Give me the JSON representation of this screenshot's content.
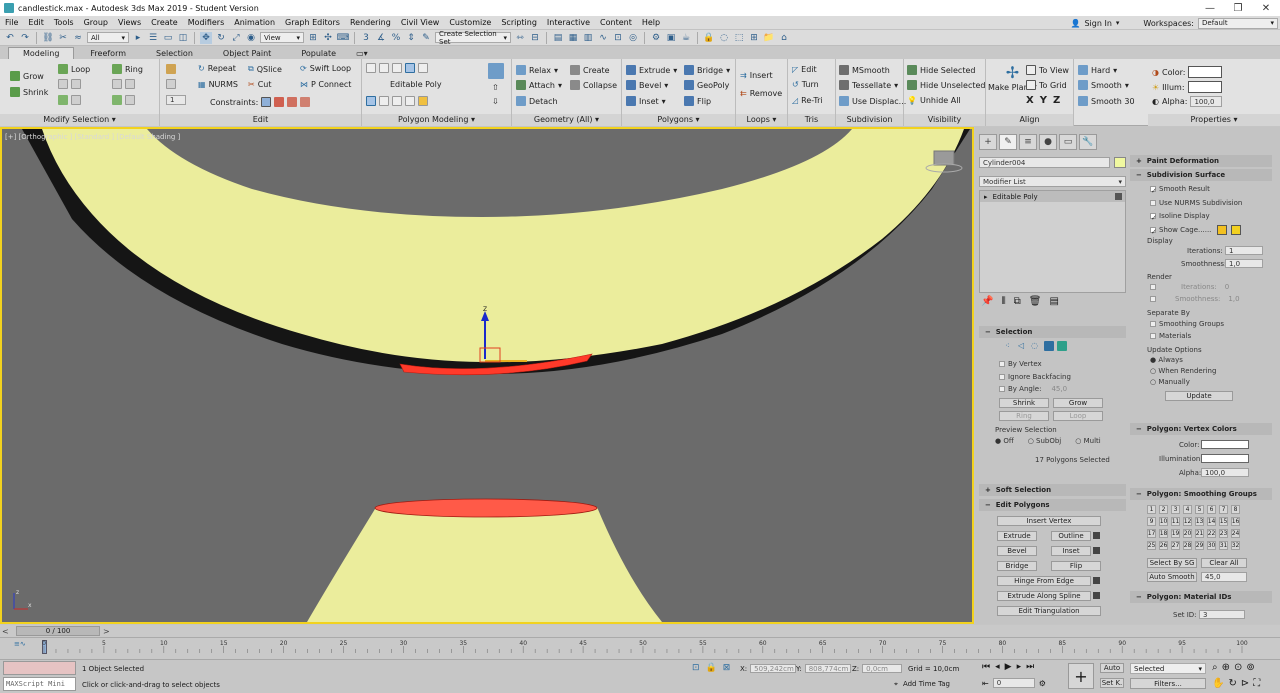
{
  "window": {
    "title": "candlestick.max - Autodesk 3ds Max 2019 - Student Version"
  },
  "menu": {
    "items": [
      "File",
      "Edit",
      "Tools",
      "Group",
      "Views",
      "Create",
      "Modifiers",
      "Animation",
      "Graph Editors",
      "Rendering",
      "Civil View",
      "Customize",
      "Scripting",
      "Interactive",
      "Content",
      "Help"
    ],
    "sign_in": "Sign In",
    "workspaces_label": "Workspaces:",
    "workspaces_value": "Default"
  },
  "toolbar": {
    "filter": "All",
    "coord": "View",
    "selection_set": "Create Selection Set"
  },
  "ribbon_tabs": [
    "Modeling",
    "Freeform",
    "Selection",
    "Object Paint",
    "Populate"
  ],
  "ribbon": {
    "modify_selection": {
      "label": "Modify Selection",
      "grow": "Grow",
      "shrink": "Shrink",
      "loop": "Loop",
      "ring": "Ring"
    },
    "edit": {
      "label": "Edit",
      "repeat": "Repeat",
      "qslice": "QSlice",
      "swift_loop": "Swift Loop",
      "nurms": "NURMS",
      "cut": "Cut",
      "p_connect": "P Connect",
      "constraints": "Constraints:",
      "spin_value": "1"
    },
    "polygon_modeling": {
      "label": "Polygon Modeling",
      "editable_poly": "Editable Poly"
    },
    "geometry": {
      "label": "Geometry (All)",
      "relax": "Relax",
      "create": "Create",
      "attach": "Attach",
      "collapse": "Collapse",
      "detach": "Detach"
    },
    "polygons": {
      "label": "Polygons",
      "extrude": "Extrude",
      "bridge": "Bridge",
      "bevel": "Bevel",
      "geopoly": "GeoPoly",
      "inset": "Inset",
      "flip": "Flip"
    },
    "loops": {
      "label": "Loops",
      "insert": "Insert",
      "remove": "Remove"
    },
    "tris": {
      "label": "Tris",
      "edit": "Edit",
      "turn": "Turn",
      "retri": "Re-Tri"
    },
    "subdivision": {
      "label": "Subdivision",
      "msmooth": "MSmooth",
      "tessellate": "Tessellate",
      "use_displac": "Use Displac..."
    },
    "visibility": {
      "label": "Visibility",
      "hide_selected": "Hide Selected",
      "hide_unselected": "Hide Unselected",
      "unhide_all": "Unhide All"
    },
    "align": {
      "label": "Align",
      "make_planar": "Make Planar",
      "to_view": "To View",
      "to_grid": "To Grid",
      "x": "X",
      "y": "Y",
      "z": "Z"
    },
    "smoothing": {
      "hard": "Hard",
      "smooth": "Smooth",
      "smooth30": "Smooth 30"
    },
    "properties": {
      "label": "Properties",
      "color": "Color:",
      "illum": "Illum:",
      "alpha": "Alpha:",
      "alpha_value": "100,0"
    }
  },
  "viewport": {
    "label": "[+] [Orthographic ] [Standard ] [Default Shading ]"
  },
  "command_panel": {
    "object_name": "Cylinder004",
    "modifier_list": "Modifier List",
    "stack_item": "Editable Poly",
    "selection": {
      "title": "Selection",
      "by_vertex": "By Vertex",
      "ignore_backfacing": "Ignore Backfacing",
      "by_angle": "By Angle:",
      "angle_value": "45,0",
      "shrink": "Shrink",
      "grow": "Grow",
      "ring": "Ring",
      "loop": "Loop",
      "preview_selection": "Preview Selection",
      "off": "Off",
      "subobj": "SubObj",
      "multi": "Multi",
      "status": "17 Polygons Selected"
    },
    "soft_selection": "Soft Selection",
    "edit_polygons": {
      "title": "Edit Polygons",
      "insert_vertex": "Insert Vertex",
      "extrude": "Extrude",
      "outline": "Outline",
      "bevel": "Bevel",
      "inset": "Inset",
      "bridge": "Bridge",
      "flip": "Flip",
      "hinge": "Hinge From Edge",
      "extrude_spline": "Extrude Along Spline",
      "edit_tri": "Edit Triangulation"
    },
    "paint_deformation": "Paint Deformation",
    "subdivision_surface": {
      "title": "Subdivision Surface",
      "smooth_result": "Smooth Result",
      "use_nurms": "Use NURMS Subdivision",
      "isoline": "Isoline Display",
      "show_cage": "Show Cage......",
      "display": "Display",
      "iterations": "Iterations:",
      "iter_val": "1",
      "smoothness": "Smoothness:",
      "smooth_val": "1,0",
      "render": "Render",
      "r_iter_val": "0",
      "r_smooth_val": "1,0",
      "separate_by": "Separate By",
      "smoothing_groups": "Smoothing Groups",
      "materials": "Materials",
      "update_options": "Update Options",
      "always": "Always",
      "when_rendering": "When Rendering",
      "manually": "Manually",
      "update": "Update"
    },
    "vertex_colors": {
      "title": "Polygon: Vertex Colors",
      "color": "Color:",
      "illumination": "Illumination:",
      "alpha": "Alpha:",
      "alpha_val": "100,0"
    },
    "smoothing_groups": {
      "title": "Polygon: Smoothing Groups",
      "numbers": [
        "1",
        "2",
        "3",
        "4",
        "5",
        "6",
        "7",
        "8",
        "9",
        "10",
        "11",
        "12",
        "13",
        "14",
        "15",
        "16",
        "17",
        "18",
        "19",
        "20",
        "21",
        "22",
        "23",
        "24",
        "25",
        "26",
        "27",
        "28",
        "29",
        "30",
        "31",
        "32"
      ],
      "select_by_sg": "Select By SG",
      "clear_all": "Clear All",
      "auto_smooth": "Auto Smooth",
      "auto_val": "45,0"
    },
    "material_ids": {
      "title": "Polygon: Material IDs",
      "set_id": "Set ID:",
      "set_id_val": "3"
    }
  },
  "timeline": {
    "frame": "0 / 100",
    "ticks": [
      "0",
      "5",
      "10",
      "15",
      "20",
      "25",
      "30",
      "35",
      "40",
      "45",
      "50",
      "55",
      "60",
      "65",
      "70",
      "75",
      "80",
      "85",
      "90",
      "95",
      "100"
    ]
  },
  "status": {
    "maxscript": "MAXScript Mini",
    "selected": "1 Object Selected",
    "prompt": "Click or click-and-drag to select objects",
    "x_label": "X:",
    "x_val": "509,242cm",
    "y_label": "Y:",
    "y_val": "808,774cm",
    "z_label": "Z:",
    "z_val": "0,0cm",
    "grid": "Grid = 10,0cm",
    "add_time_tag": "Add Time Tag",
    "auto": "Auto",
    "selected_dd": "Selected",
    "set_k": "Set K.",
    "filters": "Filters...",
    "frame_val": "0"
  },
  "colors": {
    "viewport_bg": "#6b6b6b",
    "object": "#ebed9c",
    "selection": "#ff3a2a",
    "border": "#f2d21e"
  }
}
